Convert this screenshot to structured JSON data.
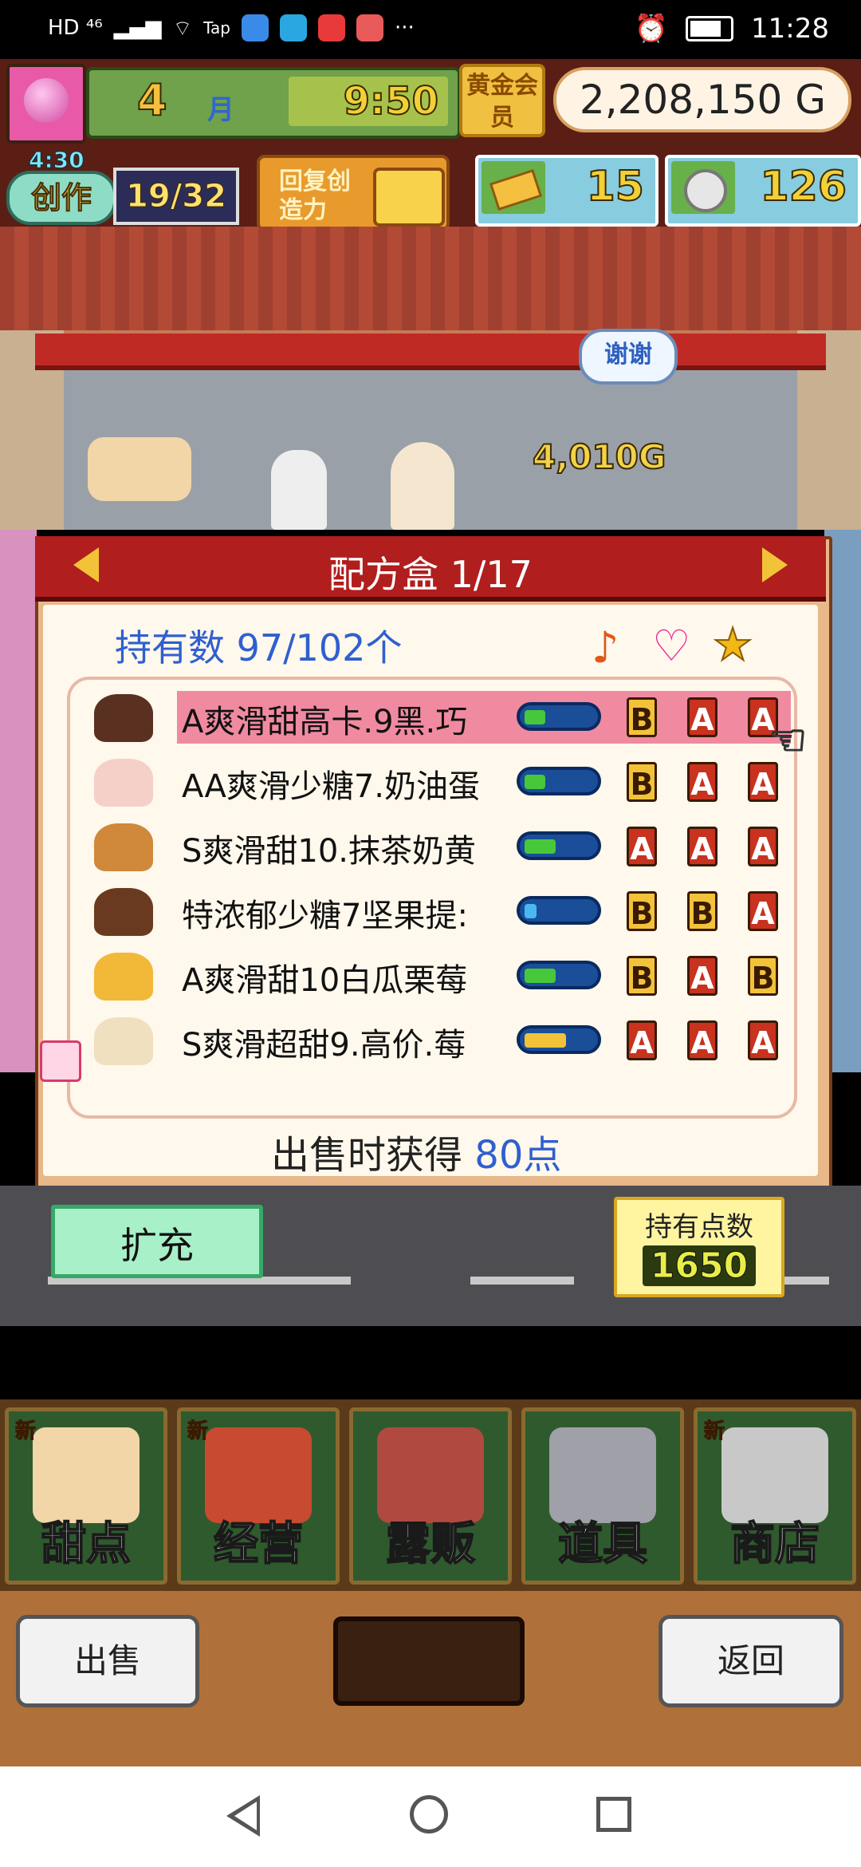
{
  "status_bar": {
    "left_text": "HD ⁴⁶",
    "tap_label": "Tap",
    "more": "···",
    "time": "11:28",
    "icons": [
      "signal-icon",
      "wifi-icon",
      "taptap-icon",
      "browser-icon",
      "telegram-icon",
      "weibo-icon",
      "app-icon",
      "alarm-icon",
      "battery-icon"
    ]
  },
  "hud": {
    "month": "4",
    "month_unit": "月",
    "clock": "9:50",
    "gold_member": "黄金会员",
    "money": "2,208,150 G",
    "create_time": "4:30",
    "create_label": "创作",
    "create_count": "19/32",
    "recover_label": "回复创造力",
    "tickets": "15",
    "coins": "126"
  },
  "scene": {
    "bubble": "谢谢",
    "price": "4,010G"
  },
  "recipe_panel": {
    "title": "配方盒 1/17",
    "owned": "持有数 97/102个",
    "sale_label": "出售时获得",
    "sale_value": "80点",
    "rows": [
      {
        "name": "A爽滑甜高卡.9黑.巧",
        "bar_level": 0.3,
        "bar_color": "#46c83a",
        "grades": [
          "B",
          "A",
          "A"
        ],
        "icon_color": "#5a3020",
        "selected": true
      },
      {
        "name": "AA爽滑少糖7.奶油蛋",
        "bar_level": 0.3,
        "bar_color": "#46c83a",
        "grades": [
          "B",
          "A",
          "A"
        ],
        "icon_color": "#f4d0c8",
        "selected": false
      },
      {
        "name": "S爽滑甜10.抹茶奶黄",
        "bar_level": 0.45,
        "bar_color": "#46c83a",
        "grades": [
          "A",
          "A",
          "A"
        ],
        "icon_color": "#d0883a",
        "selected": false
      },
      {
        "name": "特浓郁少糖7坚果提:",
        "bar_level": 0.18,
        "bar_color": "#4ab8f0",
        "grades": [
          "B",
          "B",
          "A"
        ],
        "icon_color": "#6a3a20",
        "selected": false
      },
      {
        "name": "A爽滑甜10白瓜栗莓",
        "bar_level": 0.45,
        "bar_color": "#46c83a",
        "grades": [
          "B",
          "A",
          "B"
        ],
        "icon_color": "#f2b838",
        "selected": false
      },
      {
        "name": "S爽滑超甜9.高价.莓",
        "bar_level": 0.6,
        "bar_color": "#f2c238",
        "grades": [
          "A",
          "A",
          "A"
        ],
        "icon_color": "#f0e0c0",
        "selected": false
      }
    ]
  },
  "actions": {
    "expand": "扩充",
    "points_label": "持有点数",
    "points_value": "1650"
  },
  "menu": {
    "items": [
      {
        "label": "甜点",
        "new": "新",
        "color": "#f2d6a8"
      },
      {
        "label": "经营",
        "new": "新",
        "color": "#c84a30"
      },
      {
        "label": "露贩",
        "new": "",
        "color": "#b04a40"
      },
      {
        "label": "道具",
        "new": "",
        "color": "#a0a0a8"
      },
      {
        "label": "商店",
        "new": "新",
        "color": "#c8c8c8"
      }
    ]
  },
  "bottom": {
    "sell": "出售",
    "back": "返回"
  }
}
